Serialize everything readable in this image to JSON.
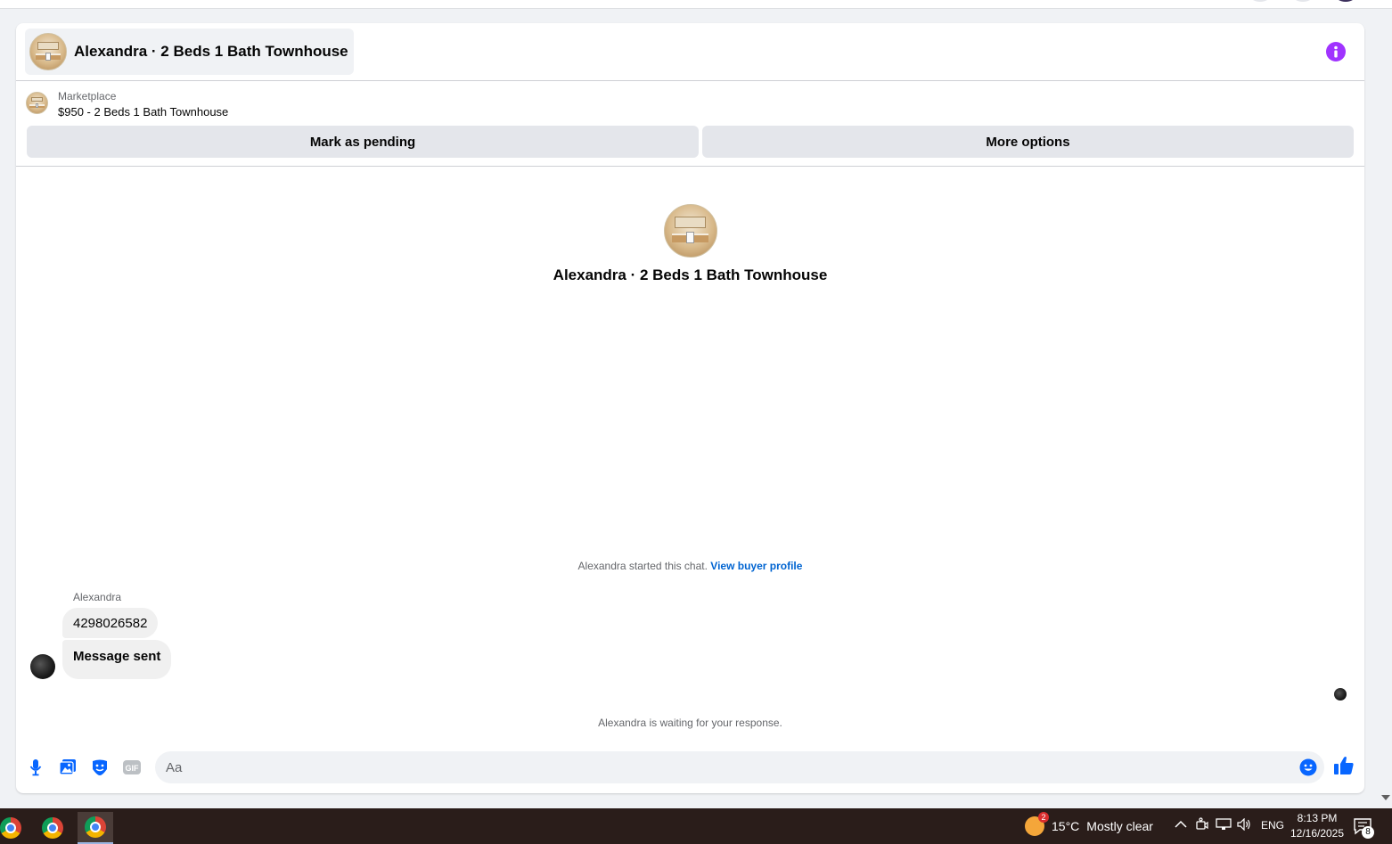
{
  "header": {
    "title": "Alexandra · 2 Beds 1 Bath Townhouse"
  },
  "listing": {
    "source": "Marketplace",
    "title": "$950 - 2 Beds 1 Bath Townhouse"
  },
  "actions": {
    "mark_pending": "Mark as pending",
    "more_options": "More options"
  },
  "conversation": {
    "profile_name": "Alexandra · 2 Beds 1 Bath Townhouse",
    "started_text": "Alexandra started this chat.",
    "view_profile_link": "View buyer profile",
    "sender": "Alexandra",
    "messages": [
      "4298026582",
      "Message sent"
    ],
    "waiting_text": "Alexandra is waiting for your response."
  },
  "composer": {
    "placeholder": "Aa"
  },
  "colors": {
    "accent": "#0866ff",
    "info": "#a033ff",
    "link": "#0064d1"
  },
  "taskbar": {
    "weather": {
      "temp": "15°C",
      "condition": "Mostly clear",
      "badge": "2"
    },
    "language": "ENG",
    "time": "8:13 PM",
    "date": "12/16/2025",
    "notification_count": "8"
  }
}
